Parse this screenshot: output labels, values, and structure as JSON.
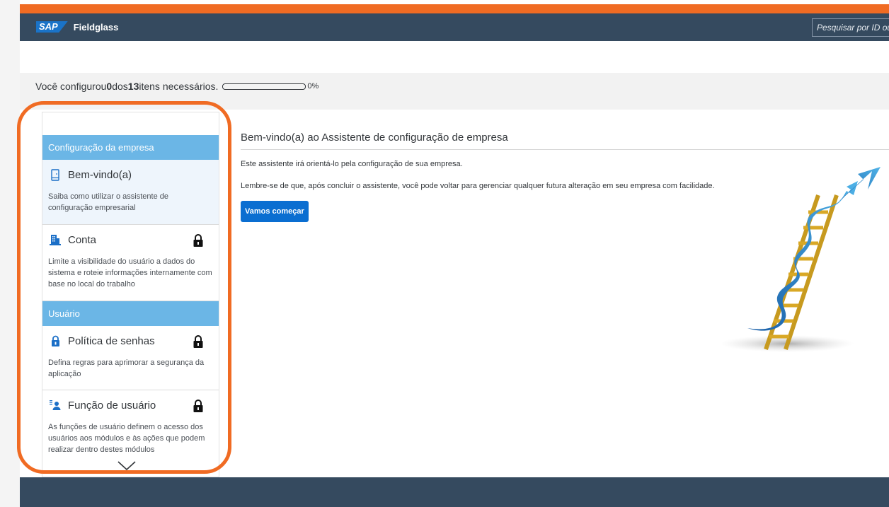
{
  "header": {
    "sap_label": "SAP",
    "brand": "Fieldglass",
    "search_placeholder": "Pesquisar por ID ou"
  },
  "progress": {
    "prefix": "Você configurou ",
    "done": "0",
    "middle": " dos ",
    "total": "13",
    "suffix": " itens necessários.",
    "percent_label": "0%",
    "fraction": 0
  },
  "sidebar": {
    "section_company": "Configuração da empresa",
    "section_user": "Usuário",
    "items": [
      {
        "title": "Bem-vindo(a)",
        "desc": "Saiba como utilizar o assistente de configuração empresarial",
        "icon": "phone-icon",
        "locked": false
      },
      {
        "title": "Conta",
        "desc": "Limite a visibilidade do usuário a dados do sistema e roteie informações internamente com base no local do trabalho",
        "icon": "building-icon",
        "locked": true
      },
      {
        "title": "Política de senhas",
        "desc": "Defina regras para aprimorar a segurança da aplicação",
        "icon": "lock-icon",
        "locked": true
      },
      {
        "title": "Função de usuário",
        "desc": "As funções de usuário definem o acesso dos usuários aos módulos e às ações que podem realizar dentro destes módulos",
        "icon": "user-role-icon",
        "locked": true
      }
    ]
  },
  "main": {
    "title": "Bem-vindo(a) ao Assistente de configuração de empresa",
    "para1": "Este assistente irá orientá-lo pela configuração de sua empresa.",
    "para2": "Lembre-se de que, após concluir o assistente, você pode voltar para gerenciar qualquer futura alteração em seu empresa com facilidade.",
    "start_button": "Vamos começar"
  },
  "colors": {
    "accent_orange": "#f06b23",
    "header_bg": "#354a5f",
    "section_blue": "#6bb6e6",
    "button_blue": "#0a6ed1"
  }
}
